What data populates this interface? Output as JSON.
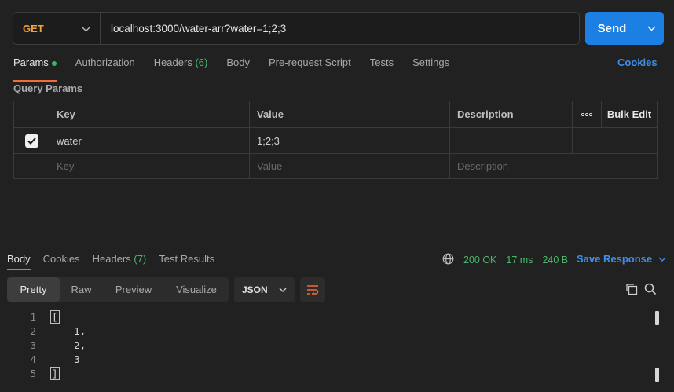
{
  "request": {
    "method": "GET",
    "url": "localhost:3000/water-arr?water=1;2;3",
    "send_label": "Send"
  },
  "request_tabs": [
    {
      "label": "Params",
      "active": true,
      "dot": true
    },
    {
      "label": "Authorization"
    },
    {
      "label": "Headers",
      "count": "(6)"
    },
    {
      "label": "Body"
    },
    {
      "label": "Pre-request Script"
    },
    {
      "label": "Tests"
    },
    {
      "label": "Settings"
    }
  ],
  "cookies_label": "Cookies",
  "query_params": {
    "title": "Query Params",
    "headers": {
      "key": "Key",
      "value": "Value",
      "description": "Description",
      "more": "ooo",
      "bulk_edit": "Bulk Edit"
    },
    "rows": [
      {
        "checked": true,
        "key": "water",
        "value": "1;2;3",
        "description": ""
      }
    ],
    "placeholder": {
      "key": "Key",
      "value": "Value",
      "description": "Description"
    }
  },
  "response_tabs": [
    {
      "label": "Body",
      "active": true
    },
    {
      "label": "Cookies"
    },
    {
      "label": "Headers",
      "count": "(7)"
    },
    {
      "label": "Test Results"
    }
  ],
  "response_status": {
    "status": "200 OK",
    "time": "17 ms",
    "size": "240 B"
  },
  "save_response_label": "Save Response",
  "view_modes": [
    "Pretty",
    "Raw",
    "Preview",
    "Visualize"
  ],
  "active_view": "Pretty",
  "format": "JSON",
  "body_lines": [
    {
      "n": "1",
      "text": "["
    },
    {
      "n": "2",
      "text": "    1,"
    },
    {
      "n": "3",
      "text": "    2,"
    },
    {
      "n": "4",
      "text": "    3"
    },
    {
      "n": "5",
      "text": "]"
    }
  ],
  "colors": {
    "accent": "#1b7fe3",
    "method": "#f3a13b",
    "success": "#4ab86b",
    "active_tab": "#f26b3a",
    "link": "#3f8ee8"
  }
}
